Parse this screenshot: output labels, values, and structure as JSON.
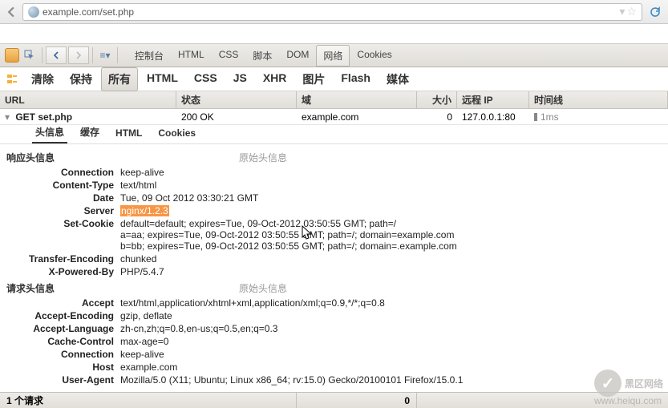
{
  "url": "example.com/set.php",
  "toolbar_panels": [
    "控制台",
    "HTML",
    "CSS",
    "脚本",
    "DOM",
    "网络",
    "Cookies"
  ],
  "active_panel": 5,
  "filters": [
    "清除",
    "保持",
    "所有",
    "HTML",
    "CSS",
    "JS",
    "XHR",
    "图片",
    "Flash",
    "媒体"
  ],
  "active_filter": 2,
  "columns": {
    "url": "URL",
    "status": "状态",
    "domain": "域",
    "size": "大小",
    "ip": "远程 IP",
    "timeline": "时间线"
  },
  "request": {
    "method": "GET",
    "file": "set.php",
    "status": "200 OK",
    "domain": "example.com",
    "size": "0",
    "ip": "127.0.0.1:80",
    "time": "1ms"
  },
  "detail_tabs": [
    "头信息",
    "缓存",
    "HTML",
    "Cookies"
  ],
  "active_detail": 0,
  "sections": {
    "response": {
      "title": "响应头信息",
      "raw": "原始头信息"
    },
    "request": {
      "title": "请求头信息",
      "raw": "原始头信息"
    }
  },
  "response_headers": [
    {
      "name": "Connection",
      "value": "keep-alive"
    },
    {
      "name": "Content-Type",
      "value": "text/html"
    },
    {
      "name": "Date",
      "value": "Tue, 09 Oct 2012 03:30:21 GMT"
    },
    {
      "name": "Server",
      "value": "nginx/1.2.3",
      "highlight": true
    },
    {
      "name": "Set-Cookie",
      "value": "default=default; expires=Tue, 09-Oct-2012 03:50:55 GMT; path=/\na=aa; expires=Tue, 09-Oct-2012 03:50:55 GMT; path=/; domain=example.com\nb=bb; expires=Tue, 09-Oct-2012 03:50:55 GMT; path=/; domain=.example.com"
    },
    {
      "name": "Transfer-Encoding",
      "value": "chunked"
    },
    {
      "name": "X-Powered-By",
      "value": "PHP/5.4.7"
    }
  ],
  "request_headers": [
    {
      "name": "Accept",
      "value": "text/html,application/xhtml+xml,application/xml;q=0.9,*/*;q=0.8"
    },
    {
      "name": "Accept-Encoding",
      "value": "gzip, deflate"
    },
    {
      "name": "Accept-Language",
      "value": "zh-cn,zh;q=0.8,en-us;q=0.5,en;q=0.3"
    },
    {
      "name": "Cache-Control",
      "value": "max-age=0"
    },
    {
      "name": "Connection",
      "value": "keep-alive"
    },
    {
      "name": "Host",
      "value": "example.com"
    },
    {
      "name": "User-Agent",
      "value": "Mozilla/5.0 (X11; Ubuntu; Linux x86_64; rv:15.0) Gecko/20100101 Firefox/15.0.1"
    }
  ],
  "status": {
    "requests": "1 个请求",
    "total": "0"
  },
  "watermark": {
    "text": "黑区网络",
    "sub": "www.heiqu.com"
  }
}
